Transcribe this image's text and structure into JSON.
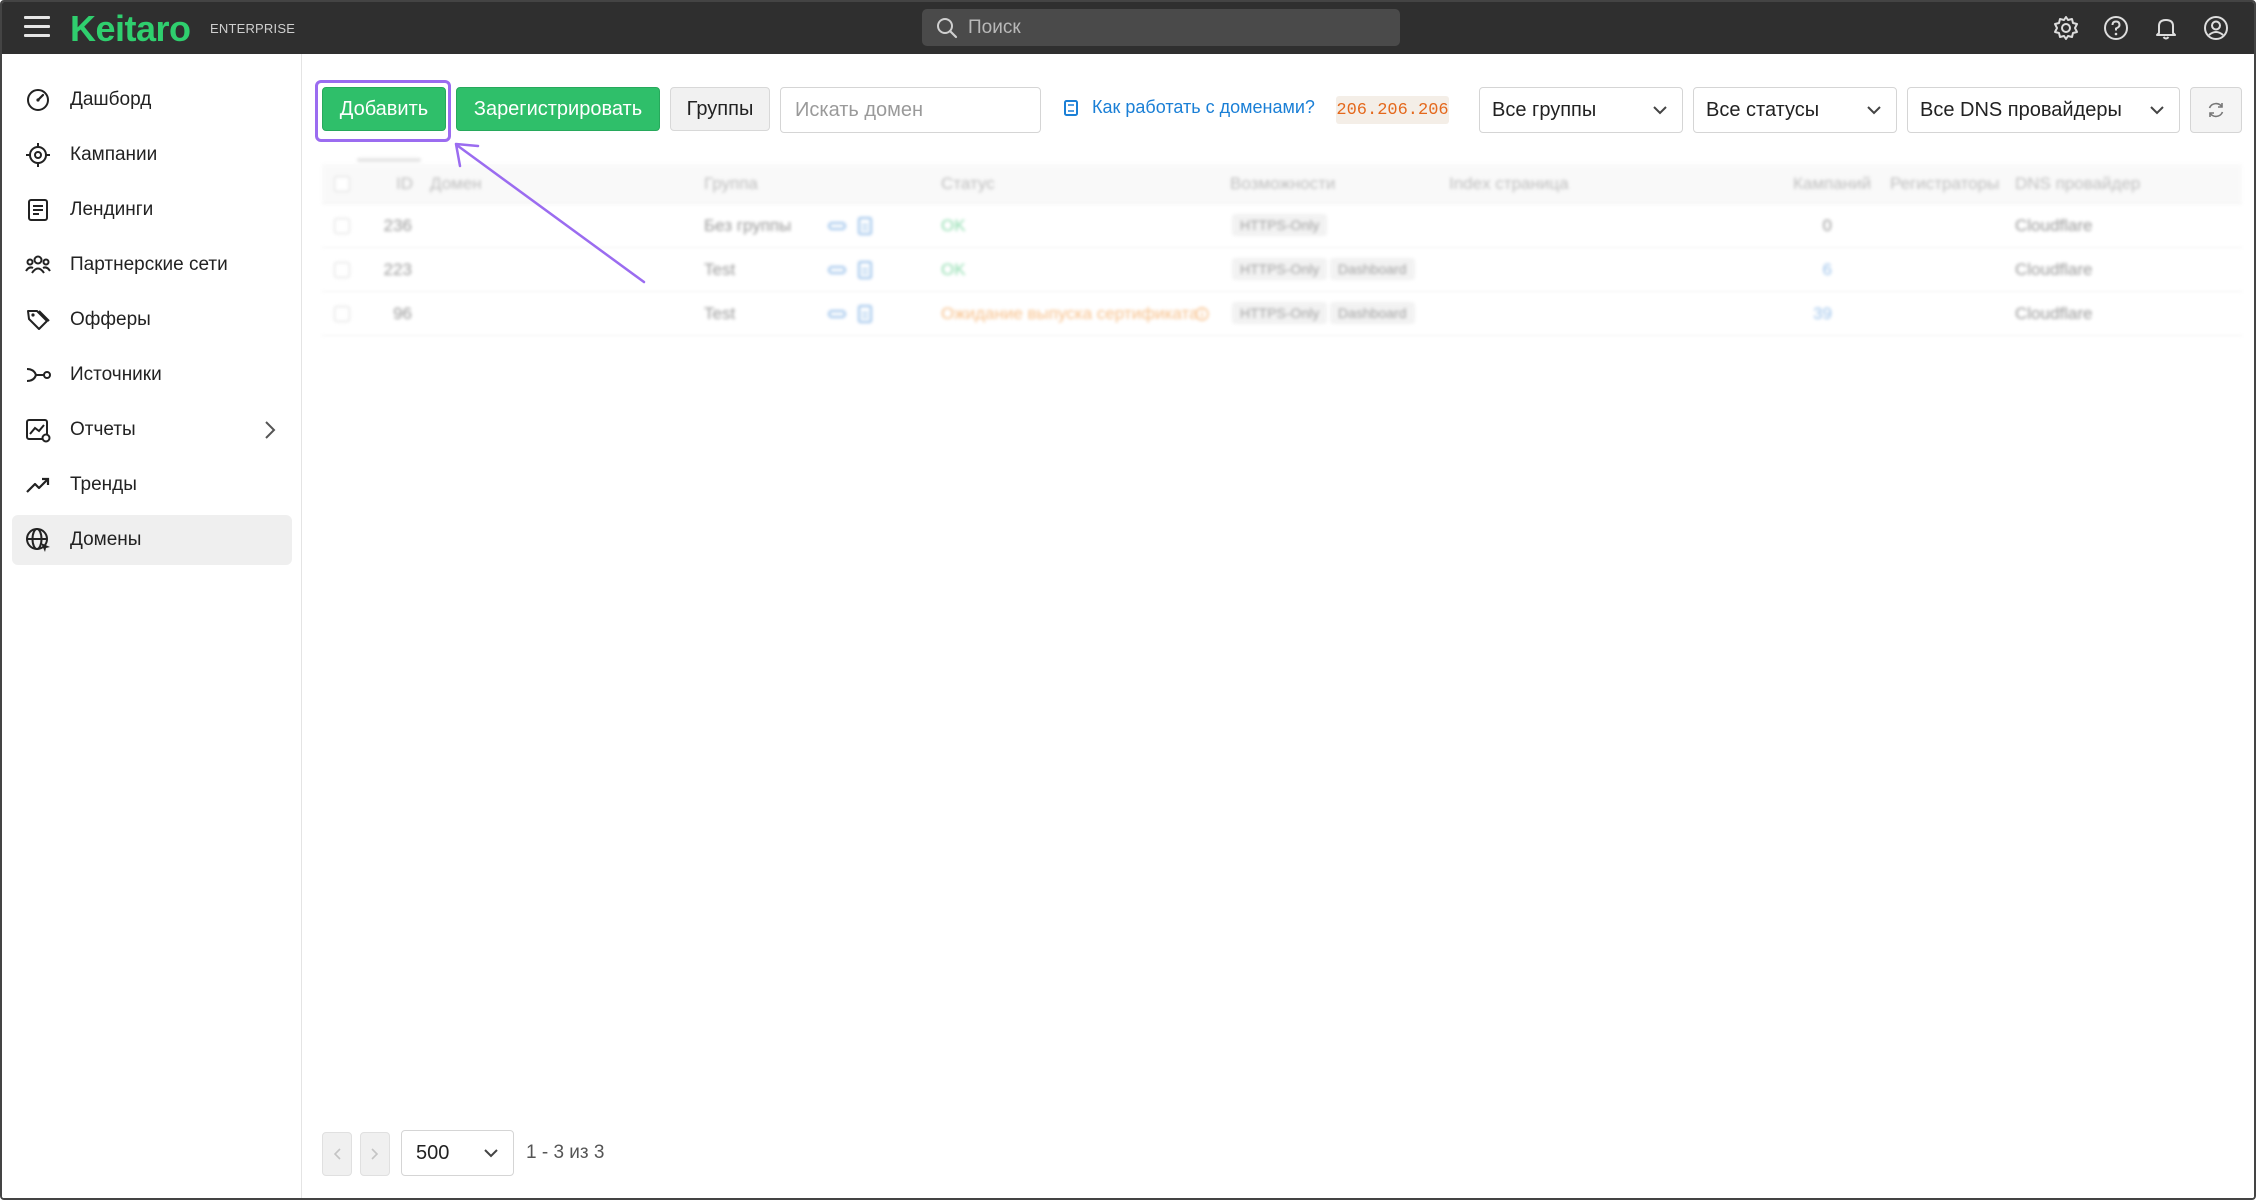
{
  "app": {
    "logo": "Keitaro",
    "edition": "ENTERPRISE",
    "search_placeholder": "Поиск"
  },
  "sidebar": {
    "items": [
      {
        "label": "Дашборд",
        "icon": "dashboard-icon"
      },
      {
        "label": "Кампании",
        "icon": "target-icon"
      },
      {
        "label": "Лендинги",
        "icon": "landing-page-icon"
      },
      {
        "label": "Партнерские сети",
        "icon": "network-icon"
      },
      {
        "label": "Офферы",
        "icon": "tags-icon"
      },
      {
        "label": "Источники",
        "icon": "source-icon"
      },
      {
        "label": "Отчеты",
        "icon": "reports-icon",
        "has_submenu": true
      },
      {
        "label": "Тренды",
        "icon": "trend-icon"
      },
      {
        "label": "Домены",
        "icon": "globe-icon",
        "active": true
      }
    ]
  },
  "toolbar": {
    "add_label": "Добавить",
    "register_label": "Зарегистрировать",
    "groups_label": "Группы",
    "search_placeholder": "Искать домен",
    "help_link": "Как работать с доменами?",
    "ip": "206.206.206",
    "filter_groups": "Все группы",
    "filter_statuses": "Все статусы",
    "filter_dns": "Все DNS провайдеры"
  },
  "table": {
    "columns": [
      "ID",
      "Домен",
      "Группа",
      "Статус",
      "Возможности",
      "Index страница",
      "Кампаний",
      "Регистраторы",
      "DNS провайдер"
    ],
    "rows": [
      {
        "id": "236",
        "domain": "",
        "group": "Без группы",
        "status": "OK",
        "status_type": "ok",
        "features": [
          "HTTPS-Only"
        ],
        "campaigns": "0",
        "dns": "Cloudflare"
      },
      {
        "id": "223",
        "domain": "",
        "group": "Test",
        "status": "OK",
        "status_type": "ok",
        "features": [
          "HTTPS-Only",
          "Dashboard"
        ],
        "campaigns": "6",
        "dns": "Cloudflare"
      },
      {
        "id": "96",
        "domain": "",
        "group": "Test",
        "status": "Ожидание выпуска сертификата",
        "status_type": "warn",
        "features": [
          "HTTPS-Only",
          "Dashboard"
        ],
        "campaigns": "39",
        "dns": "Cloudflare"
      }
    ]
  },
  "pagination": {
    "per_page": "500",
    "info": "1 - 3 из 3"
  },
  "colors": {
    "accent": "#2fbf6a",
    "highlight": "#9b6cf0",
    "link": "#1a7fd6",
    "topbar": "#2f2f2f"
  }
}
